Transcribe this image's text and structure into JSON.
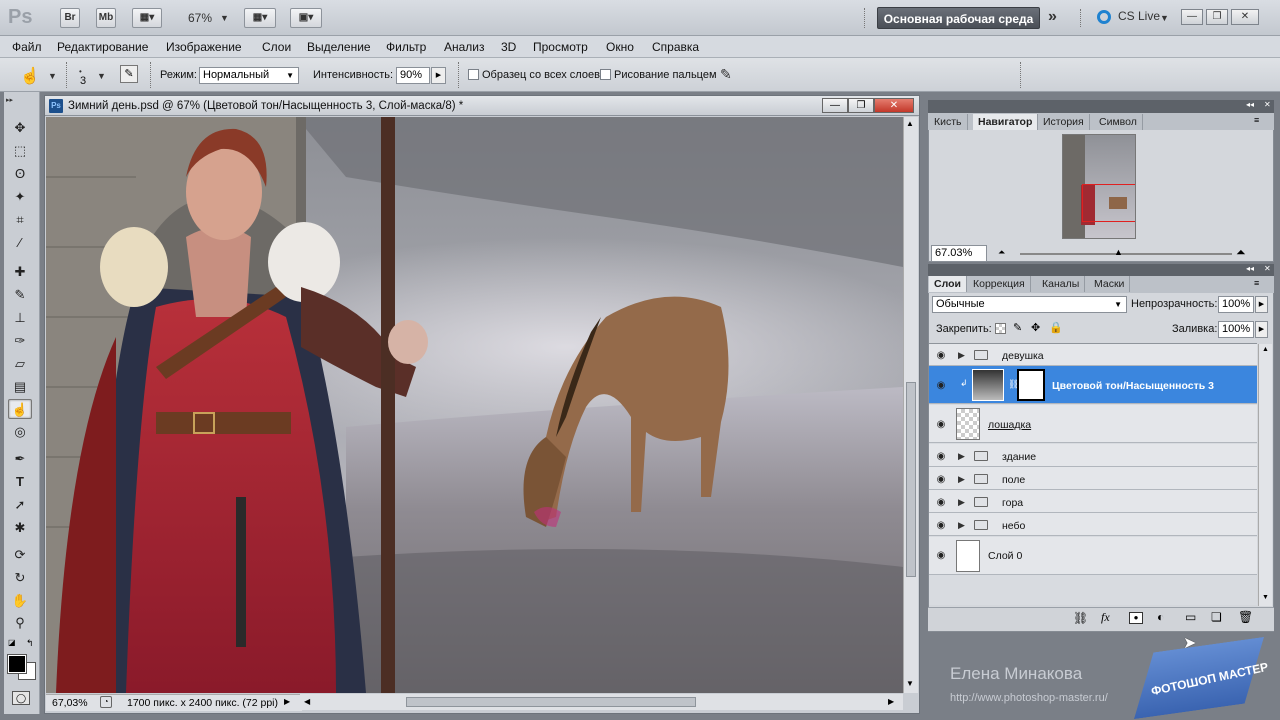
{
  "app": {
    "logo": "Ps",
    "br": "Br",
    "mb": "Mb",
    "zoom": "67%"
  },
  "workspace": {
    "label": "Основная рабочая среда",
    "more": "»",
    "cslive": "CS Live"
  },
  "menu": [
    "Файл",
    "Редактирование",
    "Изображение",
    "Слои",
    "Выделение",
    "Фильтр",
    "Анализ",
    "3D",
    "Просмотр",
    "Окно",
    "Справка"
  ],
  "options": {
    "brush_size": "3",
    "mode_label": "Режим:",
    "mode_value": "Нормальный",
    "strength_label": "Интенсивность:",
    "strength_value": "90%",
    "sample_all": "Образец со всех слоев",
    "finger_paint": "Рисование пальцем"
  },
  "document": {
    "title": "Зимний день.psd @ 67% (Цветовой тон/Насыщенность 3, Слой-маска/8) *",
    "zoom": "67,03%",
    "info": "1700 пикс. x 2400 пикс. (72 ppi)"
  },
  "nav_panel": {
    "tabs": [
      "Кисть",
      "Навигатор",
      "История",
      "Символ"
    ],
    "active_tab": "Навигатор",
    "zoom": "67.03%"
  },
  "layers_panel": {
    "tabs": [
      "Слои",
      "Коррекция",
      "Каналы",
      "Маски"
    ],
    "active_tab": "Слои",
    "blend_mode": "Обычные",
    "opacity_label": "Непрозрачность:",
    "opacity_value": "100%",
    "lock_label": "Закрепить:",
    "fill_label": "Заливка:",
    "fill_value": "100%",
    "layers": [
      {
        "name": "девушка",
        "type": "folder"
      },
      {
        "name": "Цветовой тон/Насыщенность 3",
        "type": "adjustment",
        "selected": true
      },
      {
        "name": "лошадка",
        "type": "pixel"
      },
      {
        "name": "здание",
        "type": "folder"
      },
      {
        "name": "поле",
        "type": "folder"
      },
      {
        "name": "гора",
        "type": "folder"
      },
      {
        "name": "небо",
        "type": "folder"
      },
      {
        "name": "Слой 0",
        "type": "white"
      }
    ]
  },
  "watermark": {
    "author": "Елена Минакова",
    "url": "http://www.photoshop-master.ru/",
    "logo_text": "ФОТОШОП МАСТЕР"
  },
  "colors": {
    "selection": "#3b86de",
    "ui_bg": "#d4d7dc",
    "dark_bg": "#7a7f87"
  }
}
